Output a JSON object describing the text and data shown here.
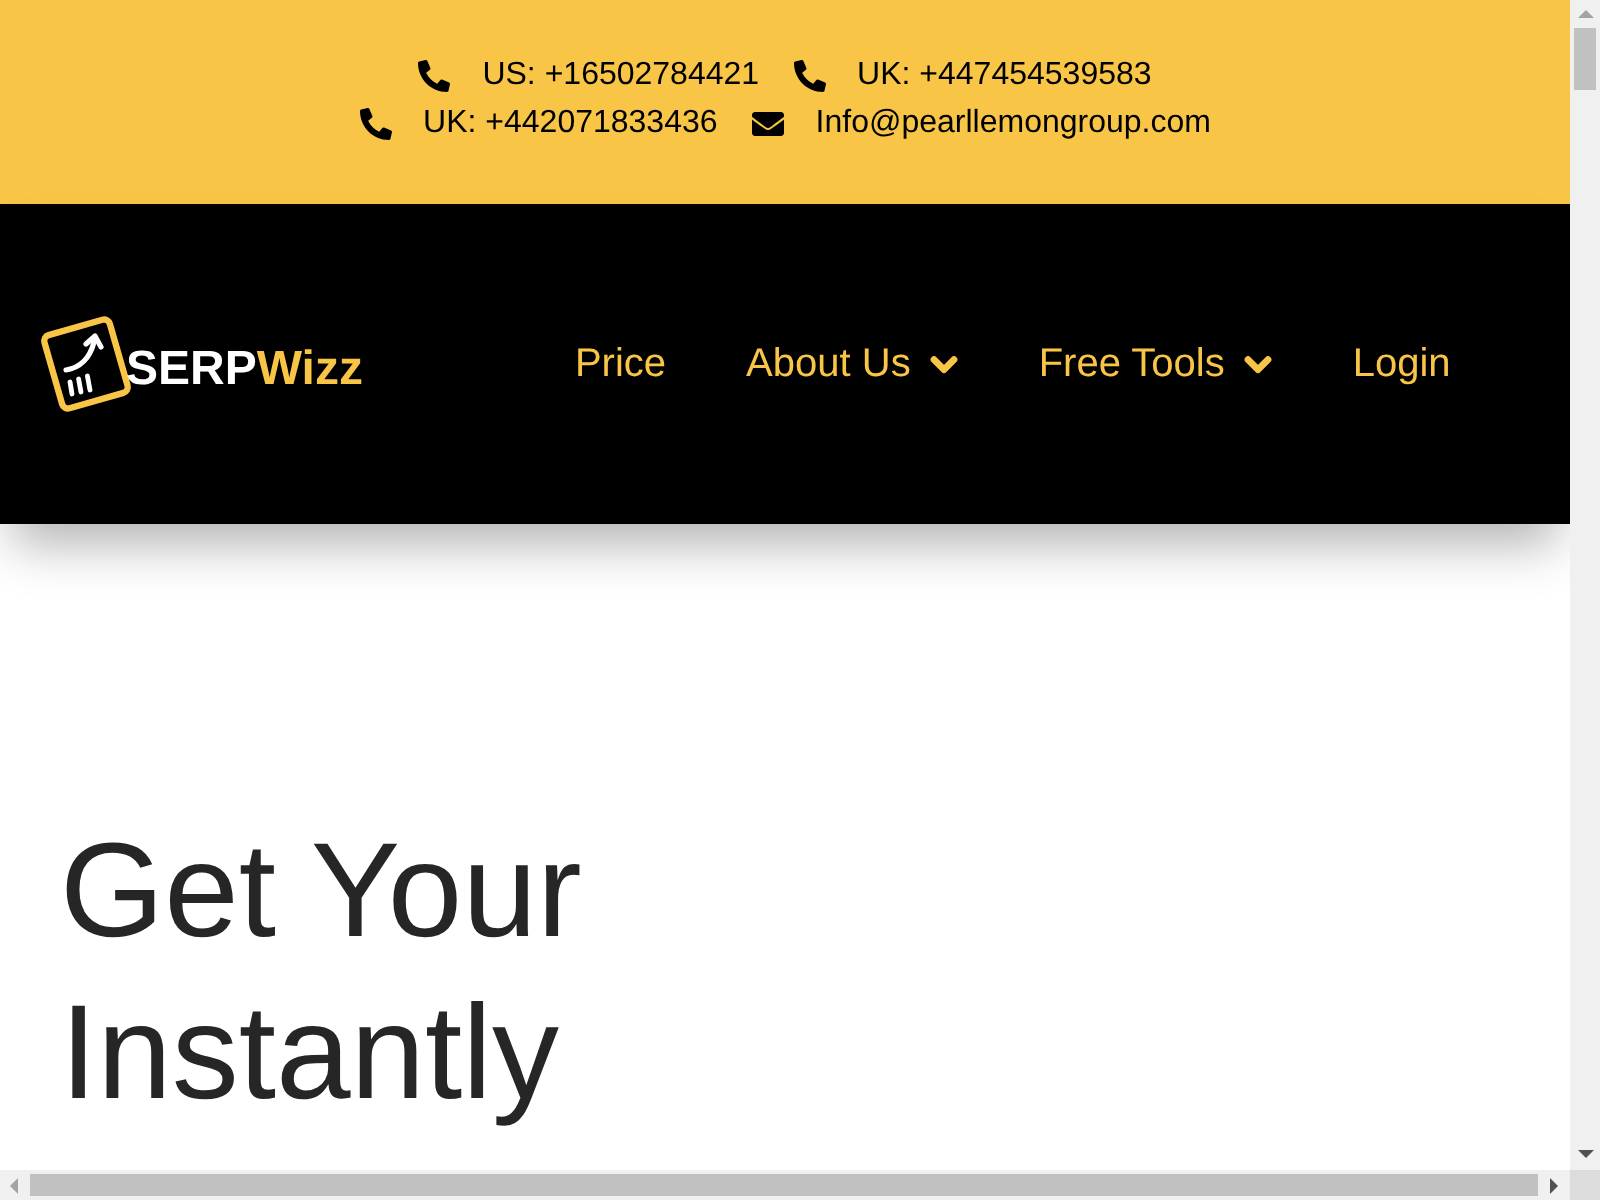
{
  "contact_bar": {
    "rows": [
      [
        {
          "kind": "phone",
          "text": "US: +16502784421"
        },
        {
          "kind": "phone",
          "text": "UK: +447454539583"
        }
      ],
      [
        {
          "kind": "phone",
          "text": "UK: +442071833436"
        },
        {
          "kind": "email",
          "text": "Info@pearllemongroup.com"
        }
      ]
    ]
  },
  "header": {
    "logo": {
      "primary": "SERP",
      "accent": "Wizz"
    },
    "nav_items": [
      {
        "label": "Price",
        "dropdown": false
      },
      {
        "label": "About Us",
        "dropdown": true
      },
      {
        "label": "Free Tools",
        "dropdown": true
      },
      {
        "label": "Login",
        "dropdown": false
      }
    ]
  },
  "hero": {
    "heading": "Get Your\nInstantly"
  }
}
